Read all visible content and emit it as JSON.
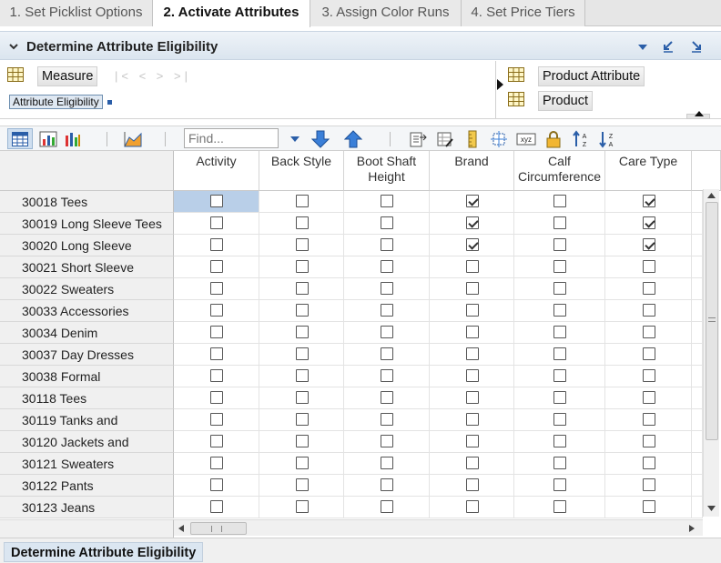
{
  "tabs": [
    {
      "label": "1. Set Picklist Options",
      "active": false
    },
    {
      "label": "2. Activate Attributes",
      "active": true
    },
    {
      "label": "3. Assign Color Runs",
      "active": false
    },
    {
      "label": "4. Set Price Tiers",
      "active": false
    }
  ],
  "section": {
    "title": "Determine Attribute Eligibility"
  },
  "pivot": {
    "measure_label": "Measure",
    "measure_selected": "Attribute Eligibility",
    "product_attribute_label": "Product Attribute",
    "product_label": "Product"
  },
  "toolbar": {
    "find_placeholder": "Find...",
    "icons": [
      "grid-view-icon",
      "chart-view-icon",
      "bar-chart-icon",
      "area-chart-icon",
      "find-next-icon",
      "find-previous-icon",
      "export-icon",
      "edit-icon",
      "ruler-icon",
      "fill-icon",
      "xyz-icon",
      "lock-icon",
      "sort-ascending-icon",
      "sort-descending-icon"
    ]
  },
  "grid": {
    "columns": [
      "Activity",
      "Back Style",
      "Boot Shaft Height",
      "Brand",
      "Calf Circumference",
      "Care Type"
    ],
    "rows": [
      {
        "label": "30018 Tees",
        "values": [
          false,
          false,
          false,
          true,
          false,
          true
        ]
      },
      {
        "label": "30019 Long Sleeve Tees",
        "values": [
          false,
          false,
          false,
          true,
          false,
          true
        ]
      },
      {
        "label": "30020 Long Sleeve",
        "values": [
          false,
          false,
          false,
          true,
          false,
          true
        ]
      },
      {
        "label": "30021 Short Sleeve",
        "values": [
          false,
          false,
          false,
          false,
          false,
          false
        ]
      },
      {
        "label": "30022 Sweaters",
        "values": [
          false,
          false,
          false,
          false,
          false,
          false
        ]
      },
      {
        "label": "30033 Accessories",
        "values": [
          false,
          false,
          false,
          false,
          false,
          false
        ]
      },
      {
        "label": "30034 Denim",
        "values": [
          false,
          false,
          false,
          false,
          false,
          false
        ]
      },
      {
        "label": "30037 Day Dresses",
        "values": [
          false,
          false,
          false,
          false,
          false,
          false
        ]
      },
      {
        "label": "30038 Formal",
        "values": [
          false,
          false,
          false,
          false,
          false,
          false
        ]
      },
      {
        "label": "30118 Tees",
        "values": [
          false,
          false,
          false,
          false,
          false,
          false
        ]
      },
      {
        "label": "30119 Tanks and",
        "values": [
          false,
          false,
          false,
          false,
          false,
          false
        ]
      },
      {
        "label": "30120 Jackets and",
        "values": [
          false,
          false,
          false,
          false,
          false,
          false
        ]
      },
      {
        "label": "30121 Sweaters",
        "values": [
          false,
          false,
          false,
          false,
          false,
          false
        ]
      },
      {
        "label": "30122 Pants",
        "values": [
          false,
          false,
          false,
          false,
          false,
          false
        ]
      },
      {
        "label": "30123 Jeans",
        "values": [
          false,
          false,
          false,
          false,
          false,
          false
        ]
      }
    ]
  },
  "bottom_tab": {
    "label": "Determine Attribute Eligibility"
  },
  "colors": {
    "accent": "#2a5ea8",
    "selection": "#b9cfe8"
  }
}
